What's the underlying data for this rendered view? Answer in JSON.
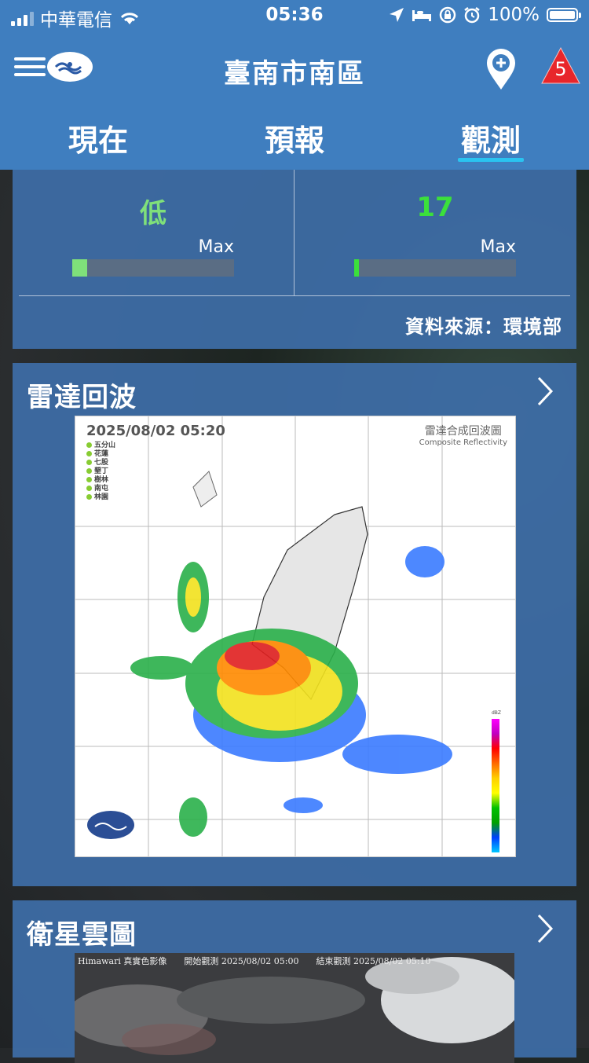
{
  "status_bar": {
    "carrier": "中華電信",
    "time": "05:36",
    "battery": "100%"
  },
  "header": {
    "title": "臺南市南區",
    "alert_count": "5"
  },
  "tabs": [
    {
      "label": "現在",
      "active": false
    },
    {
      "label": "預報",
      "active": false
    },
    {
      "label": "觀測",
      "active": true
    }
  ],
  "air_card": {
    "left": {
      "value": "低",
      "max_label": "Max",
      "level": 0.09,
      "color": "#7fe07a"
    },
    "right": {
      "value": "17",
      "max_label": "Max",
      "level": 0.03,
      "color": "#3be03b"
    },
    "source": "資料來源：環境部"
  },
  "radar_card": {
    "title": "雷達回波",
    "image": {
      "timestamp": "2025/08/02  05:20",
      "title_zh": "雷達合成回波圖",
      "title_en": "Composite Reflectivity",
      "stations": [
        "五分山",
        "花蓮",
        "七股",
        "墾丁",
        "樹林",
        "南屯",
        "林園"
      ],
      "unit": "dBZ"
    }
  },
  "satellite_card": {
    "title": "衛星雲圖",
    "image": {
      "source": "Himawari 真實色影像",
      "start": "開始觀測 2025/08/02 05:00",
      "end": "結束觀測 2025/08/02 05:10"
    }
  },
  "colors": {
    "header_blue": "#3f7ebf",
    "card_blue": "#3e6ea8",
    "tab_indicator": "#2ac3f0",
    "alert_red": "#e8262b"
  }
}
